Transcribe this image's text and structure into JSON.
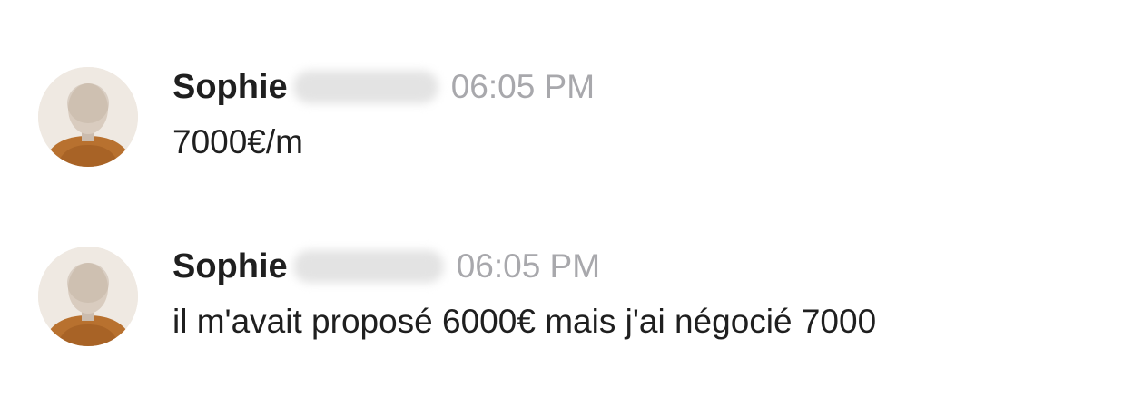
{
  "messages": [
    {
      "author": "Sophie",
      "time": "06:05 PM",
      "text": "7000€/m",
      "avatar_icon": "user-avatar-photo"
    },
    {
      "author": "Sophie",
      "time": "06:05 PM",
      "text": "il m'avait proposé 6000€ mais j'ai négocié 7000",
      "avatar_icon": "user-avatar-photo"
    }
  ],
  "colors": {
    "author_text": "#1f1f1f",
    "timestamp_text": "#a8a8ac",
    "background": "#ffffff",
    "avatar_clothing": "#b8712f"
  }
}
